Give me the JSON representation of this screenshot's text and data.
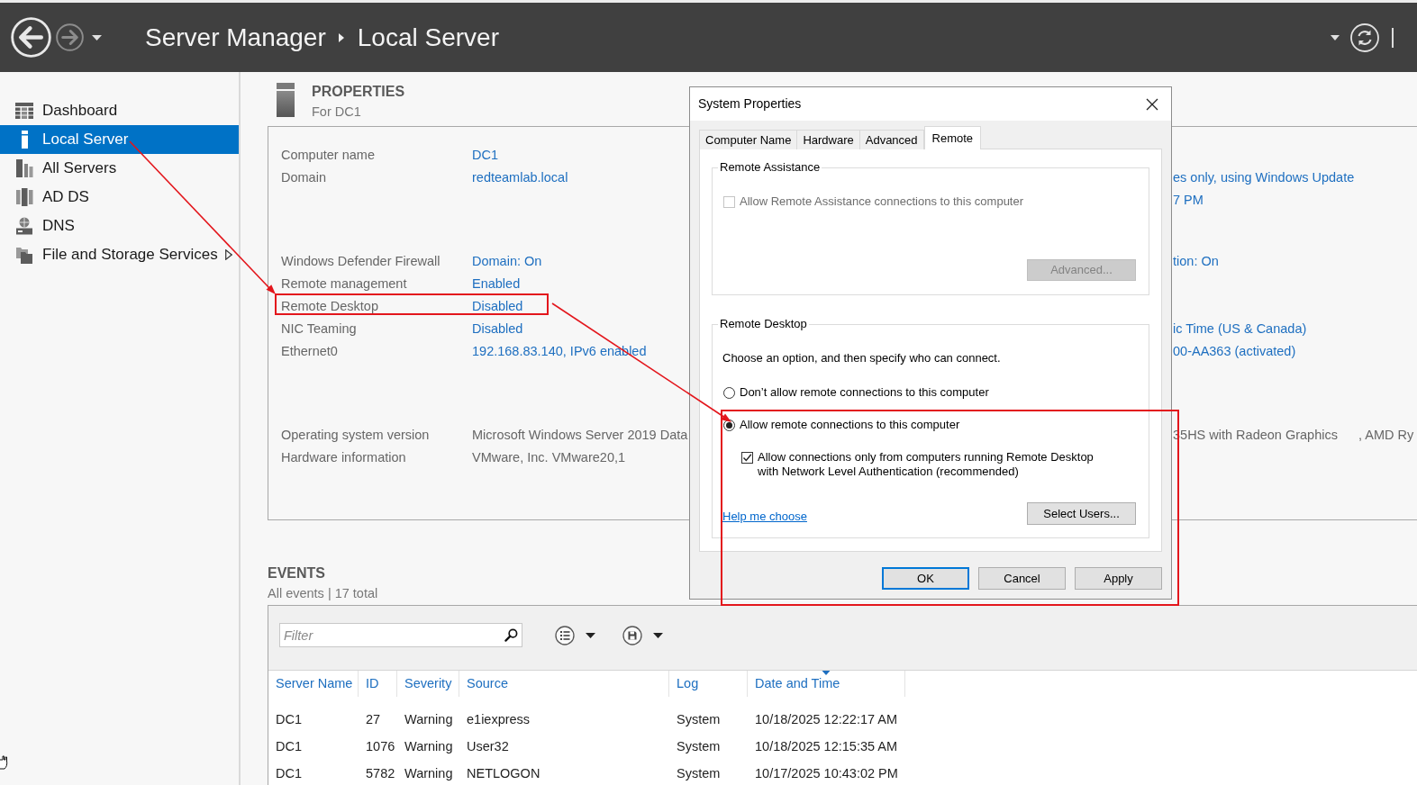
{
  "header": {
    "nav_buttons": [
      {
        "kind": "back",
        "disabled": false
      },
      {
        "kind": "forward",
        "disabled": true
      }
    ],
    "breadcrumb": [
      "Server Manager",
      "Local Server"
    ]
  },
  "sidebar": {
    "items": [
      {
        "label": "Dashboard",
        "selected": false,
        "has_submenu": false
      },
      {
        "label": "Local Server",
        "selected": true,
        "has_submenu": false
      },
      {
        "label": "All Servers",
        "selected": false,
        "has_submenu": false
      },
      {
        "label": "AD DS",
        "selected": false,
        "has_submenu": false
      },
      {
        "label": "DNS",
        "selected": false,
        "has_submenu": false
      },
      {
        "label": "File and Storage Services",
        "selected": false,
        "has_submenu": true
      }
    ]
  },
  "properties": {
    "title": "PROPERTIES",
    "subtitle": "For DC1",
    "groups": [
      {
        "rows": [
          {
            "label": "Computer name",
            "value": "DC1",
            "link": true
          },
          {
            "label": "Domain",
            "value": "redteamlab.local",
            "link": true
          }
        ]
      },
      {
        "rows": [
          {
            "label": "Windows Defender Firewall",
            "value": "Domain: On",
            "link": true
          },
          {
            "label": "Remote management",
            "value": "Enabled",
            "link": true
          },
          {
            "label": "Remote Desktop",
            "value": "Disabled",
            "link": true
          },
          {
            "label": "NIC Teaming",
            "value": "Disabled",
            "link": true
          },
          {
            "label": "Ethernet0",
            "value": "192.168.83.140, IPv6 enabled",
            "link": true
          }
        ]
      },
      {
        "rows": [
          {
            "label": "Operating system version",
            "value": "Microsoft Windows Server 2019 Data",
            "link": false
          },
          {
            "label": "Hardware information",
            "value": "VMware, Inc. VMware20,1",
            "link": false
          }
        ]
      }
    ],
    "right_column": [
      {
        "rows": [
          {
            "value": "es only, using Windows Update",
            "link": true
          },
          {
            "value": "7 PM",
            "link": true
          }
        ]
      },
      {
        "rows": [
          {
            "value": "tion: On",
            "link": true
          }
        ]
      },
      {
        "rows": [
          {
            "value": "ic Time (US & Canada)",
            "link": true
          },
          {
            "value": "00-AA363 (activated)",
            "link": true
          }
        ]
      },
      {
        "rows": [
          {
            "value": "35HS with Radeon Graphics",
            "link": false,
            "continuation": ", AMD Ry"
          }
        ]
      }
    ]
  },
  "events": {
    "title": "EVENTS",
    "subtitle": "All events | 17 total",
    "filter": {
      "placeholder": "Filter"
    },
    "columns": [
      {
        "label": "Server Name",
        "sorted": false
      },
      {
        "label": "ID",
        "sorted": false
      },
      {
        "label": "Severity",
        "sorted": false
      },
      {
        "label": "Source",
        "sorted": false
      },
      {
        "label": "Log",
        "sorted": false
      },
      {
        "label": "Date and Time",
        "sorted": true
      }
    ],
    "rows": [
      [
        "DC1",
        "27",
        "Warning",
        "e1iexpress",
        "System",
        "10/18/2025 12:22:17 AM"
      ],
      [
        "DC1",
        "1076",
        "Warning",
        "User32",
        "System",
        "10/18/2025 12:15:35 AM"
      ],
      [
        "DC1",
        "5782",
        "Warning",
        "NETLOGON",
        "System",
        "10/17/2025 10:43:02 PM"
      ]
    ]
  },
  "dialog": {
    "title": "System Properties",
    "tabs": [
      {
        "label": "Computer Name",
        "selected": false
      },
      {
        "label": "Hardware",
        "selected": false
      },
      {
        "label": "Advanced",
        "selected": false
      },
      {
        "label": "Remote",
        "selected": true
      }
    ],
    "remote_assistance": {
      "legend": "Remote Assistance",
      "checkbox": {
        "label": "Allow Remote Assistance connections to this computer",
        "checked": false,
        "disabled": true
      },
      "advanced_button": {
        "label": "Advanced...",
        "disabled": true
      }
    },
    "remote_desktop": {
      "legend": "Remote Desktop",
      "instruction": "Choose an option, and then specify who can connect.",
      "options": [
        {
          "label": "Don’t allow remote connections to this computer",
          "selected": false
        },
        {
          "label": "Allow remote connections to this computer",
          "selected": true
        }
      ],
      "nla_checkbox": {
        "label": "Allow connections only from computers running Remote Desktop with Network Level Authentication (recommended)",
        "checked": true,
        "disabled": false
      },
      "help_link": "Help me choose",
      "select_users_button": "Select Users..."
    },
    "buttons": [
      {
        "label": "OK",
        "default": true
      },
      {
        "label": "Cancel",
        "default": false
      },
      {
        "label": "Apply",
        "default": false
      }
    ]
  }
}
